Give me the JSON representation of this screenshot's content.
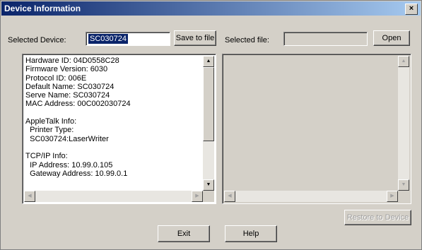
{
  "window": {
    "title": "Device Information",
    "close_label": "×"
  },
  "left": {
    "selected_device_label": "Selected Device:",
    "selected_device_value": "SC030724",
    "save_button": "Save to file",
    "info_lines": [
      "Hardware ID: 04D0558C28",
      "Firmware Version: 6030",
      "Protocol ID: 006E",
      "Default Name: SC030724",
      "Serve Name: SC030724",
      "MAC Address: 00C002030724",
      "",
      "AppleTalk Info:",
      "  Printer Type:",
      "  SC030724:LaserWriter",
      "",
      "TCP/IP Info:",
      "  IP Address: 10.99.0.105",
      "  Gateway Address: 10.99.0.1"
    ]
  },
  "right": {
    "selected_file_label": "Selected file:",
    "selected_file_value": "",
    "open_button": "Open",
    "restore_button": "Restore to Device"
  },
  "footer": {
    "exit_button": "Exit",
    "help_button": "Help"
  },
  "icons": {
    "up": "▲",
    "down": "▼",
    "left": "◀",
    "right": "▶"
  }
}
